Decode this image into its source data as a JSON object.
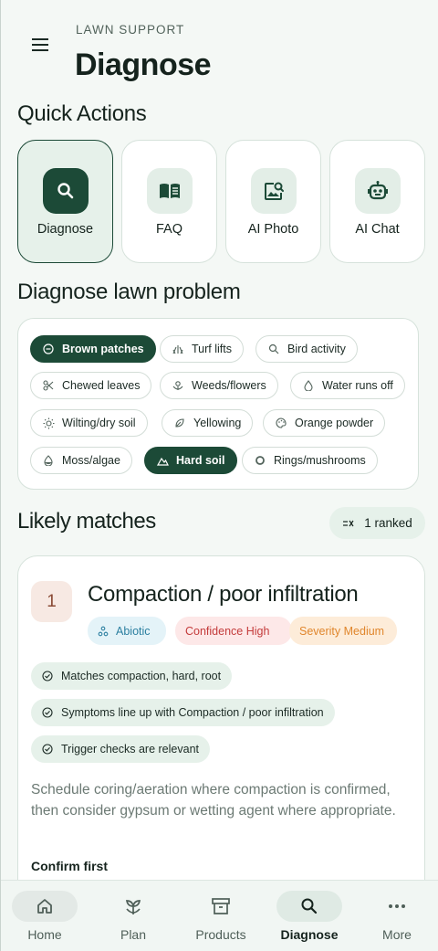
{
  "header": {
    "eyebrow": "LAWN SUPPORT",
    "title": "Diagnose"
  },
  "quick_actions": {
    "title": "Quick Actions",
    "items": [
      {
        "label": "Diagnose",
        "icon": "search-icon",
        "active": true
      },
      {
        "label": "FAQ",
        "icon": "book-icon"
      },
      {
        "label": "AI Photo",
        "icon": "image-search-icon"
      },
      {
        "label": "AI Chat",
        "icon": "robot-icon"
      }
    ]
  },
  "diagnose": {
    "title": "Diagnose lawn problem",
    "chips": [
      {
        "label": "Brown patches",
        "icon": "patch-icon",
        "selected": true
      },
      {
        "label": "Turf lifts",
        "icon": "grass-icon",
        "selected": false
      },
      {
        "label": "Bird activity",
        "icon": "search-icon",
        "selected": false
      },
      {
        "label": "Chewed leaves",
        "icon": "scissors-icon",
        "selected": false
      },
      {
        "label": "Weeds/flowers",
        "icon": "flower-icon",
        "selected": false
      },
      {
        "label": "Water runs off",
        "icon": "drop-icon",
        "selected": false
      },
      {
        "label": "Wilting/dry soil",
        "icon": "sun-icon",
        "selected": false
      },
      {
        "label": "Yellowing",
        "icon": "leaf-icon",
        "selected": false
      },
      {
        "label": "Orange powder",
        "icon": "palette-icon",
        "selected": false
      },
      {
        "label": "Moss/algae",
        "icon": "moss-icon",
        "selected": false
      },
      {
        "label": "Hard soil",
        "icon": "terrain-icon",
        "selected": true
      },
      {
        "label": "Rings/mushrooms",
        "icon": "ring-icon",
        "selected": false
      }
    ]
  },
  "likely": {
    "title": "Likely matches",
    "ranked_label": "1 ranked"
  },
  "match": {
    "rank": "1",
    "title": "Compaction / poor infiltration",
    "tags": {
      "type": "Abiotic",
      "confidence": "Confidence High",
      "severity": "Severity Medium"
    },
    "evidence": [
      "Matches compaction, hard, root",
      "Symptoms line up with Compaction / poor infiltration",
      "Trigger checks are relevant"
    ],
    "advice": "Schedule coring/aeration where compaction is confirmed, then consider gypsum or wetting agent where appropriate.",
    "confirm_label": "Confirm first"
  },
  "nav": {
    "items": [
      {
        "label": "Home",
        "icon": "home-icon"
      },
      {
        "label": "Plan",
        "icon": "sprout-icon"
      },
      {
        "label": "Products",
        "icon": "archive-icon"
      },
      {
        "label": "Diagnose",
        "icon": "search-icon",
        "active": true
      },
      {
        "label": "More",
        "icon": "more-icon"
      }
    ]
  },
  "colors": {
    "primary": "#1c4a37",
    "background": "#f4f8f5",
    "surface": "#ffffff",
    "accent_tint": "#e6f1ea",
    "abiotic": "#2b7fa0",
    "confidence": "#c43b3b",
    "severity": "#e0862c"
  }
}
